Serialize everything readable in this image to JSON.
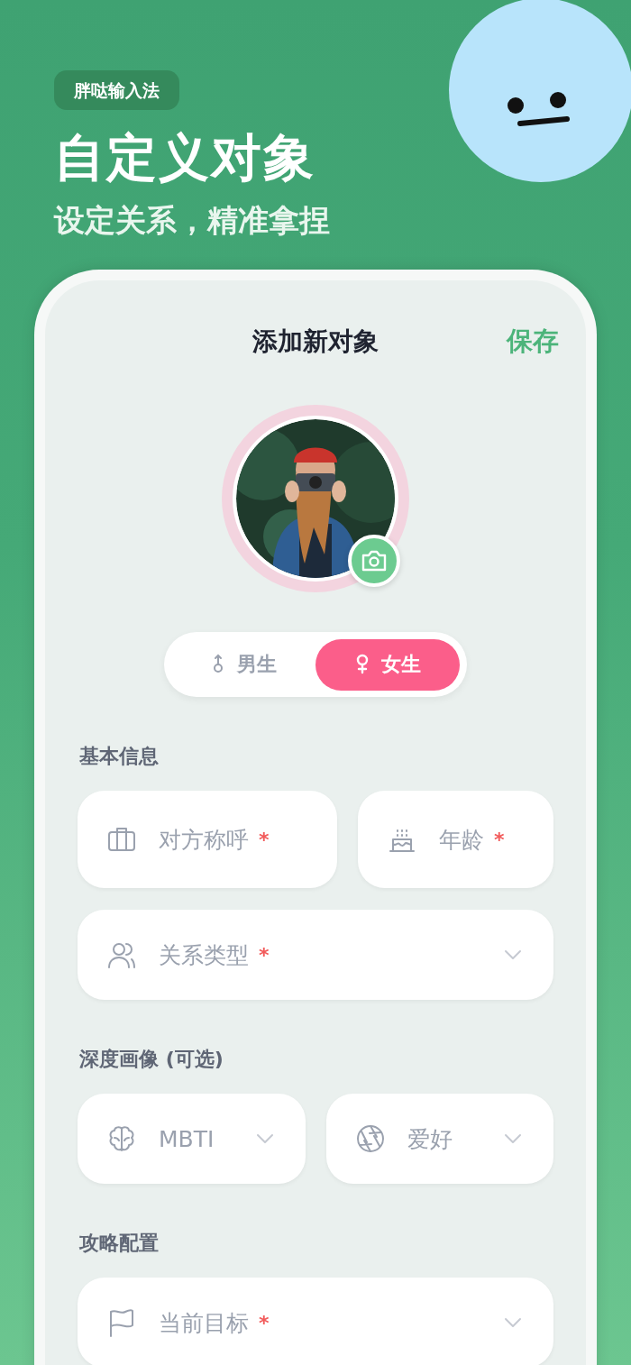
{
  "brand_badge": "胖哒输入法",
  "headline": "自定义对象",
  "subheadline": "设定关系，精准拿捏",
  "screen": {
    "title": "添加新对象",
    "save_button": "保存",
    "gender": [
      {
        "label": "男生",
        "selected": false
      },
      {
        "label": "女生",
        "selected": true
      }
    ],
    "sections": [
      {
        "title": "基本信息",
        "rows": [
          [
            {
              "placeholder": "对方称呼",
              "required_mark": "*",
              "dropdown": false
            },
            {
              "placeholder": "年龄",
              "required_mark": "*",
              "dropdown": false
            }
          ],
          [
            {
              "placeholder": "关系类型",
              "required_mark": "*",
              "dropdown": true
            }
          ]
        ]
      },
      {
        "title": "深度画像 (可选)",
        "rows": [
          [
            {
              "placeholder": "MBTI",
              "dropdown": true
            },
            {
              "placeholder": "爱好",
              "dropdown": true
            }
          ]
        ]
      },
      {
        "title": "攻略配置",
        "rows": [
          [
            {
              "placeholder": "当前目标",
              "required_mark": "*",
              "dropdown": true
            }
          ]
        ]
      }
    ]
  }
}
